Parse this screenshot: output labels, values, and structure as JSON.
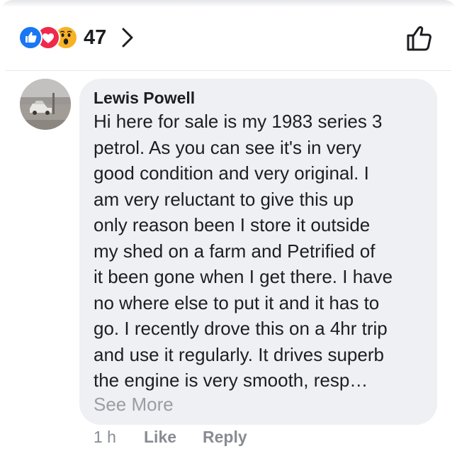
{
  "reactions": {
    "icons": [
      "like-icon",
      "love-icon",
      "wow-icon"
    ],
    "count": "47",
    "colors": {
      "like": "#1877f2",
      "love": "#f0284a",
      "wow": "#f7b125"
    }
  },
  "comment": {
    "author": "Lewis Powell",
    "text": "Hi here for sale is my 1983 series 3\npetrol. As you can see it's in very\ngood condition and very original. I\nam very reluctant to give this up\nonly reason been I store it outside\nmy shed on a farm and Petrified of\nit been gone when I get there. I have\nno where else to put it and it has to\ngo. I recently drove this on a 4hr trip\nand use it regularly. It drives superb\nthe engine is very smooth, resp…",
    "see_more": "See More"
  },
  "actions": {
    "time": "1 h",
    "like": "Like",
    "reply": "Reply"
  }
}
